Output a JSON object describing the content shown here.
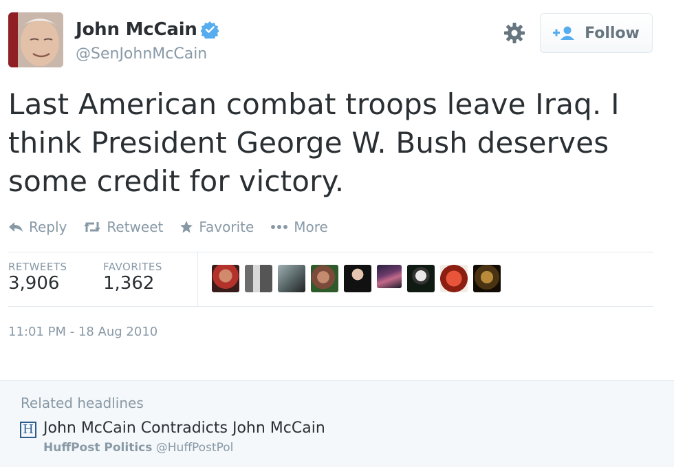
{
  "author": {
    "name": "John McCain",
    "handle": "@SenJohnMcCain",
    "verified": true
  },
  "header": {
    "follow_label": "Follow",
    "gear_icon": "gear-icon",
    "follow_icon": "add-user-icon"
  },
  "tweet": {
    "text": "Last American combat troops leave Iraq. I think President George W. Bush deserves some credit for victory.",
    "timestamp": "11:01 PM - 18 Aug 2010"
  },
  "actions": [
    {
      "label": "Reply",
      "icon": "reply-icon"
    },
    {
      "label": "Retweet",
      "icon": "retweet-icon"
    },
    {
      "label": "Favorite",
      "icon": "star-icon"
    },
    {
      "label": "More",
      "icon": "more-dots-icon"
    }
  ],
  "stats": {
    "retweets_label": "RETWEETS",
    "retweets_value": "3,906",
    "favorites_label": "FAVORITES",
    "favorites_value": "1,362"
  },
  "colors": {
    "verified_blue": "#55acee",
    "muted_text": "#8899a6",
    "text": "#292f33",
    "huffpost_blue": "#2b5d91",
    "related_bg": "#f5f8fa"
  },
  "related": {
    "title": "Related headlines",
    "headline": "John McCain Contradicts John McCain",
    "source_name": "HuffPost Politics",
    "source_handle": "@HuffPostPol",
    "source_icon_letter": "H"
  }
}
